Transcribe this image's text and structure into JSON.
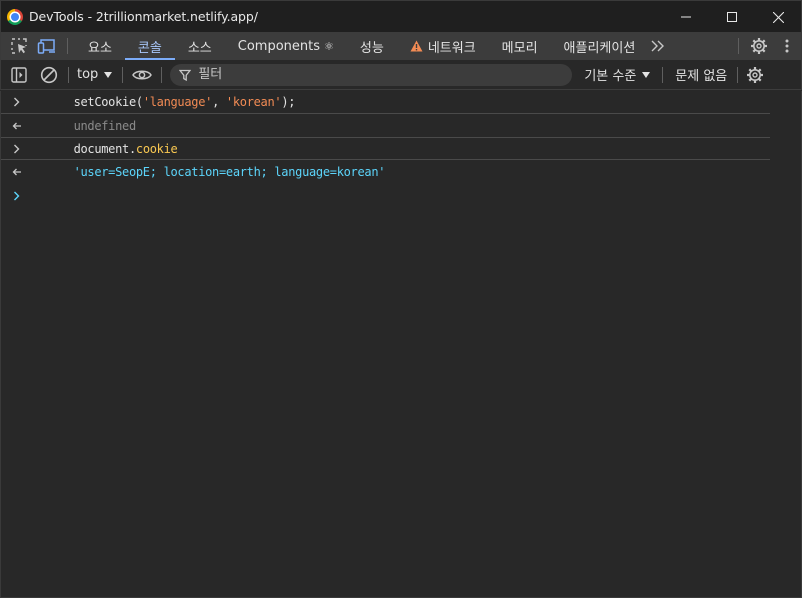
{
  "window": {
    "title": "DevTools - 2trillionmarket.netlify.app/"
  },
  "tabs": [
    {
      "label": "요소"
    },
    {
      "label": "콘솔"
    },
    {
      "label": "소스"
    },
    {
      "label": "Components",
      "glyph": "⚛"
    },
    {
      "label": "성능"
    },
    {
      "label": "네트워크"
    },
    {
      "label": "메모리"
    },
    {
      "label": "애플리케이션"
    }
  ],
  "console_toolbar": {
    "context": "top",
    "filter_placeholder": "필터",
    "levels": "기본 수준",
    "issues": "문제 없음"
  },
  "messages": [
    {
      "type": "input",
      "parts": [
        {
          "text": "setCookie(",
          "cls": "c-plain"
        },
        {
          "text": "'language'",
          "cls": "c-string"
        },
        {
          "text": ", ",
          "cls": "c-plain"
        },
        {
          "text": "'korean'",
          "cls": "c-string"
        },
        {
          "text": ");",
          "cls": "c-plain"
        }
      ]
    },
    {
      "type": "result",
      "parts": [
        {
          "text": "undefined",
          "cls": "c-undef"
        }
      ]
    },
    {
      "type": "input",
      "parts": [
        {
          "text": "document.",
          "cls": "c-plain"
        },
        {
          "text": "cookie",
          "cls": "c-prop"
        }
      ]
    },
    {
      "type": "result",
      "parts": [
        {
          "text": "'user=SeopE; location=earth; language=korean'",
          "cls": "c-result"
        }
      ]
    }
  ],
  "colors": {
    "accent": "#7cacf8",
    "active_tab_text": "#a8c7fa",
    "warning": "#f28b54",
    "prompt": "#5cd5fb"
  }
}
